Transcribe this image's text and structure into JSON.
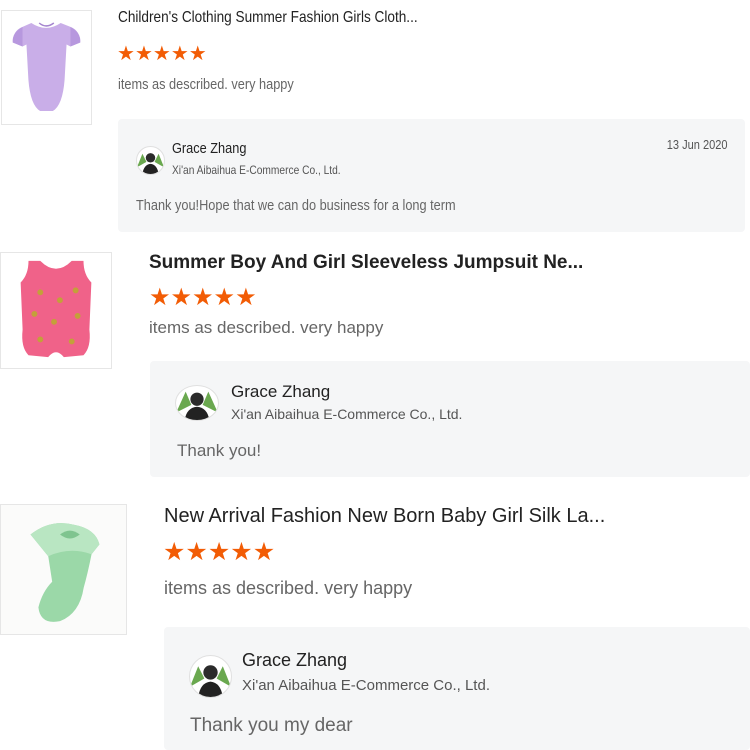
{
  "reviews": [
    {
      "product_title": "Children's Clothing Summer Fashion Girls Cloth...",
      "rating": 5,
      "comment": "items as described. very happy",
      "reply": {
        "name": "Grace Zhang",
        "company": "Xi'an Aibaihua E-Commerce Co., Ltd.",
        "date": "13 Jun 2020",
        "text": "Thank you!Hope that we can do business for a long term"
      }
    },
    {
      "product_title": "Summer Boy And Girl Sleeveless Jumpsuit Ne...",
      "rating": 5,
      "comment": "items as described. very happy",
      "reply": {
        "name": "Grace Zhang",
        "company": "Xi'an Aibaihua E-Commerce Co., Ltd.",
        "text": "Thank you!"
      }
    },
    {
      "product_title": "New Arrival Fashion New Born Baby Girl Silk La...",
      "rating": 5,
      "comment": "items as described. very happy",
      "reply": {
        "name": "Grace Zhang",
        "company": "Xi'an Aibaihua E-Commerce Co., Ltd.",
        "text": "Thank you my dear"
      }
    }
  ],
  "icons": {
    "star": "star-icon",
    "avatar": "seller-avatar-icon"
  },
  "colors": {
    "star": "#f25c05",
    "reply_bg": "#f5f6f7"
  }
}
